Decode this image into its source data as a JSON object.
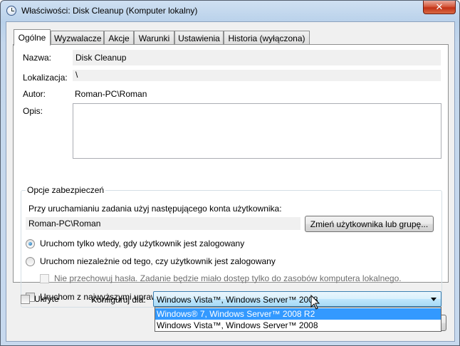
{
  "window": {
    "title": "Właściwości: Disk Cleanup (Komputer lokalny)",
    "close_glyph": "✕"
  },
  "tabs": [
    {
      "label": "Ogólne",
      "active": true
    },
    {
      "label": "Wyzwalacze"
    },
    {
      "label": "Akcje"
    },
    {
      "label": "Warunki"
    },
    {
      "label": "Ustawienia"
    },
    {
      "label": "Historia (wyłączona)"
    }
  ],
  "general": {
    "name_label": "Nazwa:",
    "name_value": "Disk Cleanup",
    "location_label": "Lokalizacja:",
    "location_value": "\\",
    "author_label": "Autor:",
    "author_value": "Roman-PC\\Roman",
    "description_label": "Opis:",
    "description_value": ""
  },
  "security": {
    "group_title": "Opcje zabezpieczeń",
    "account_prompt": "Przy uruchamianiu zadania użyj następującego konta użytkownika:",
    "account_value": "Roman-PC\\Roman",
    "change_button": "Zmień użytkownika lub grupę...",
    "radio_logged_on": "Uruchom tylko wtedy, gdy użytkownik jest zalogowany",
    "radio_any": "Uruchom niezależnie od tego, czy użytkownik jest zalogowany",
    "no_store_password": "Nie przechowuj hasła. Zadanie będzie miało dostęp tylko do zasobów komputera lokalnego.",
    "highest_privileges": "Uruchom z najwyższymi uprawnieniami"
  },
  "bottom": {
    "hidden_label": "Ukryte",
    "configure_label": "Konfiguruj dla:",
    "configure_value": "Windows Vista™, Windows Server™ 2008",
    "options": [
      "Windows® 7, Windows Server™ 2008 R2",
      "Windows Vista™, Windows Server™ 2008"
    ]
  },
  "colors": {
    "accent": "#3399ff",
    "close": "#c23216"
  }
}
